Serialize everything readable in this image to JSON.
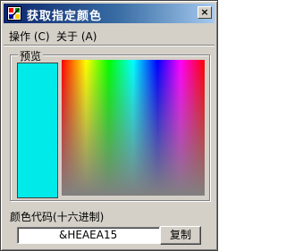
{
  "window": {
    "title": "获取指定颜色",
    "close_glyph": "×"
  },
  "menu": {
    "items": [
      {
        "label": "操作",
        "accel": "(C)",
        "accel_letter": "C"
      },
      {
        "label": "关于",
        "accel": "(A)",
        "accel_letter": "A"
      }
    ]
  },
  "preview": {
    "label": "预览",
    "color": "#00EAEA"
  },
  "color_code": {
    "label": "颜色代码(十六进制)",
    "value": "&HEAEA15",
    "copy_label": "复制"
  },
  "icons": {
    "app": "palette-icon",
    "close": "close-icon"
  }
}
